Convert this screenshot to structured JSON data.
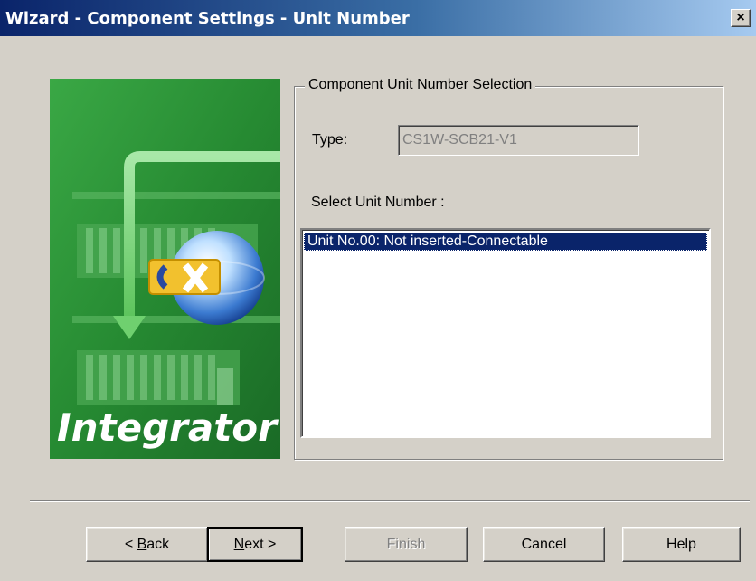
{
  "window": {
    "title": "Wizard - Component Settings - Unit Number",
    "close_symbol": "×"
  },
  "logo": {
    "product_name": "Integrator",
    "icon": "cx-integrator-logo"
  },
  "group": {
    "legend": "Component Unit Number Selection",
    "type_label": "Type:",
    "type_value": "CS1W-SCB21-V1",
    "select_label": "Select Unit Number :",
    "list_items": [
      "Unit No.00: Not inserted-Connectable"
    ],
    "selected_index": 0
  },
  "buttons": {
    "back": {
      "prefix": "< ",
      "mnemonic": "B",
      "rest": "ack"
    },
    "next": {
      "mnemonic": "N",
      "rest": "ext >"
    },
    "finish": "Finish",
    "cancel": "Cancel",
    "help": "Help"
  },
  "colors": {
    "dialog_bg": "#d4d0c8",
    "title_start": "#0a246a",
    "title_end": "#a6caf0",
    "selection": "#0a246a",
    "logo_green": "#2f9a3a"
  }
}
